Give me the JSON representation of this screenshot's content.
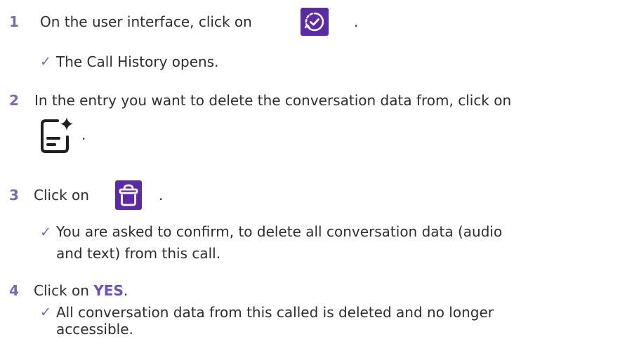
{
  "colors": {
    "step_number": "#7c67b8",
    "accent": "#5b2aa8",
    "icon_bg": "#5b2aa8",
    "text": "#2e2e2e",
    "check": "#7c67b8",
    "link": "#6a50c0"
  },
  "steps": [
    {
      "number": "1",
      "text_before": "On the user interface, click on",
      "icon": "call-history-icon",
      "text_after": ".",
      "result": "The Call History opens."
    },
    {
      "number": "2",
      "text": "In the entry you want to delete the conversation data from, click on",
      "icon": "ai-document-icon",
      "text_after": "."
    },
    {
      "number": "3",
      "text_before": "Click on",
      "icon": "trash-icon",
      "text_after": ".",
      "result_line1": "You are asked to confirm, to delete all conversation data (audio",
      "result_line2": "and text) from this call."
    },
    {
      "number": "4",
      "text_before": "Click on",
      "link": "YES",
      "text_after": ".",
      "result_line1": "All conversation data from this called is deleted and no longer",
      "result_line2": "accessible."
    }
  ],
  "check_mark": "✓"
}
